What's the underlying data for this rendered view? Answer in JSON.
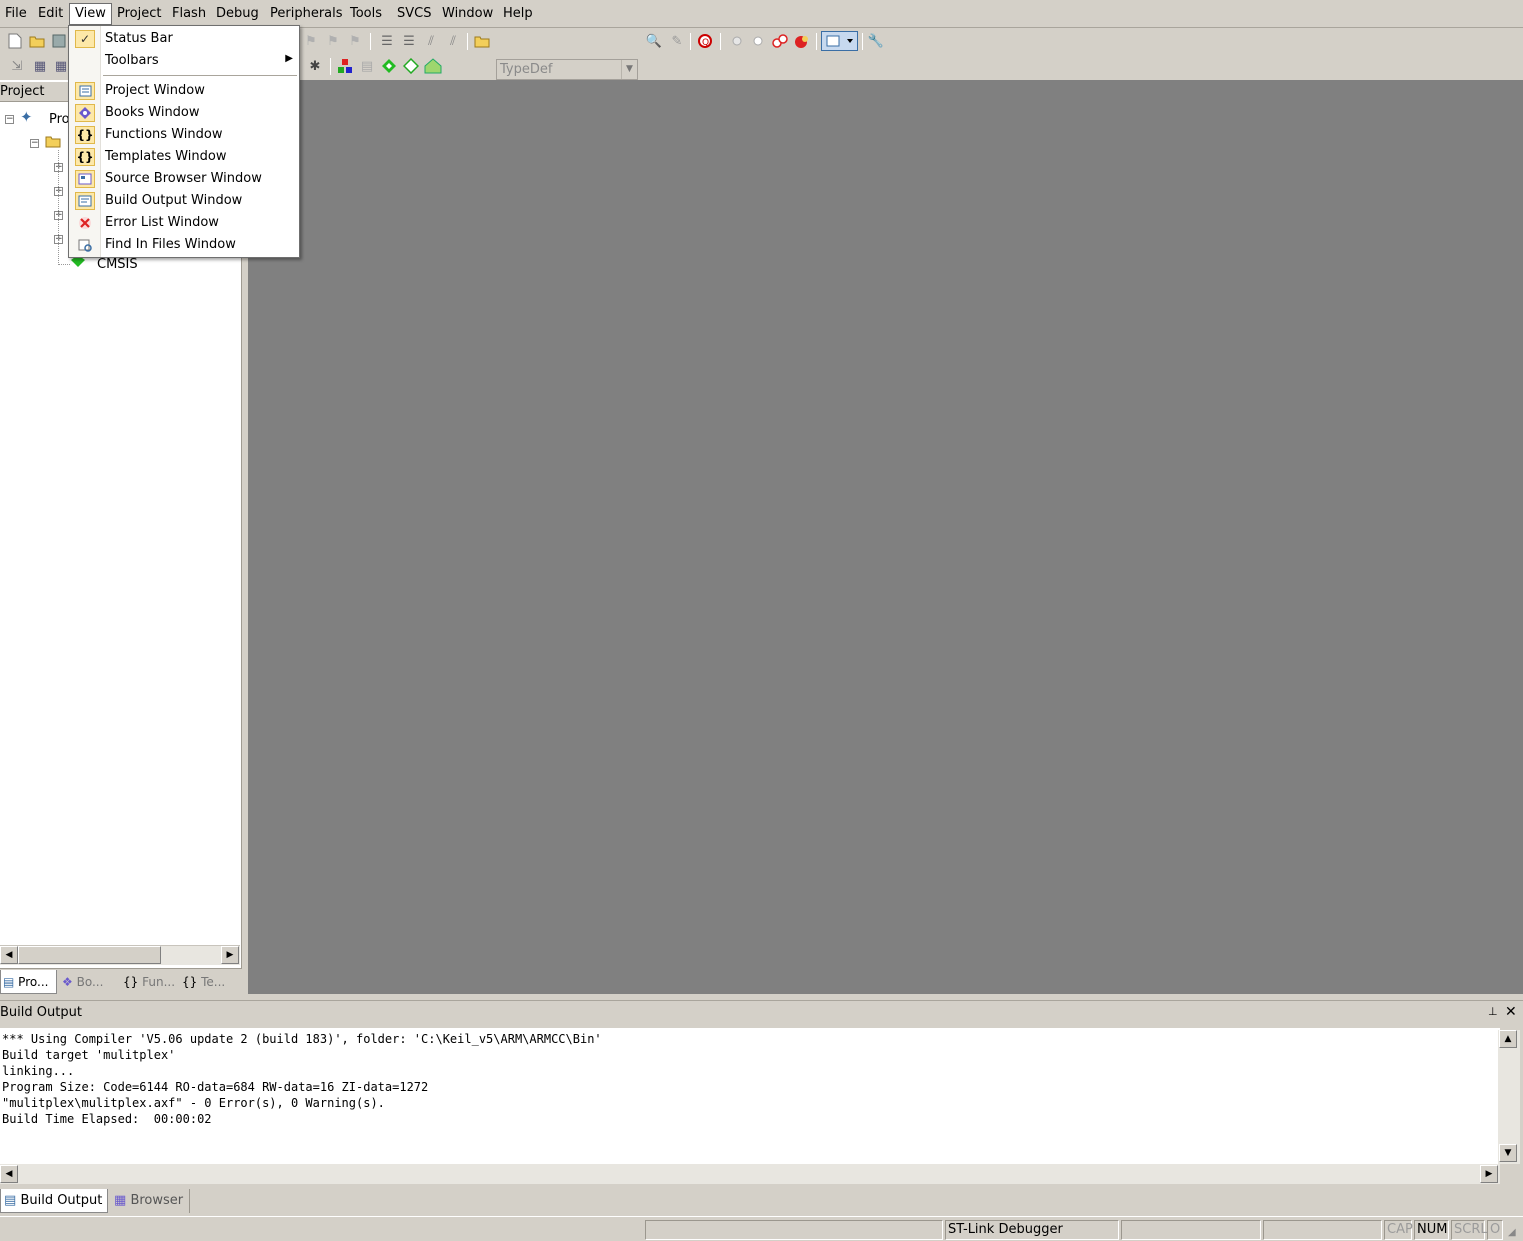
{
  "menubar": {
    "items": [
      "File",
      "Edit",
      "View",
      "Project",
      "Flash",
      "Debug",
      "Peripherals",
      "Tools",
      "SVCS",
      "Window",
      "Help"
    ]
  },
  "toolbar": {
    "find_combo_value": "TypeDef"
  },
  "view_menu": {
    "items": [
      {
        "label": "Status Bar",
        "icon": "check-icon",
        "checked": true
      },
      {
        "label": "Toolbars",
        "icon": "",
        "submenu": true
      },
      {
        "label": "Project Window",
        "icon": "project-window-icon"
      },
      {
        "label": "Books Window",
        "icon": "books-window-icon"
      },
      {
        "label": "Functions Window",
        "icon": "functions-window-icon"
      },
      {
        "label": "Templates Window",
        "icon": "templates-window-icon"
      },
      {
        "label": "Source Browser Window",
        "icon": "source-browser-icon"
      },
      {
        "label": "Build Output Window",
        "icon": "build-output-icon"
      },
      {
        "label": "Error List Window",
        "icon": "error-list-icon"
      },
      {
        "label": "Find In Files Window",
        "icon": "find-in-files-icon"
      }
    ],
    "submenu_arrow": "▶",
    "check_mark": "✓"
  },
  "project_panel": {
    "title": "Project",
    "tree": {
      "root_label": "Pro",
      "cmsis_label": "CMSIS"
    },
    "tabs": [
      "Pro...",
      "Bo...",
      "Fun...",
      "Te..."
    ]
  },
  "build_output": {
    "title": "Build Output",
    "lines": [
      "*** Using Compiler 'V5.06 update 2 (build 183)', folder: 'C:\\Keil_v5\\ARM\\ARMCC\\Bin'",
      "Build target 'mulitplex'",
      "linking...",
      "Program Size: Code=6144 RO-data=684 RW-data=16 ZI-data=1272",
      "\"mulitplex\\mulitplex.axf\" - 0 Error(s), 0 Warning(s).",
      "Build Time Elapsed:  00:00:02"
    ],
    "pin_glyph": "📌",
    "close_glyph": "✕"
  },
  "bottom_tabs": [
    "Build Output",
    "Browser"
  ],
  "statusbar": {
    "debugger": "ST-Link Debugger",
    "cap": "CAP",
    "num": "NUM",
    "scrl": "SCRL",
    "ovr": "O"
  },
  "colors": {
    "chrome": "#d4d0c8",
    "editor_bg": "#808080",
    "menu_highlight_border": "#e0b84a"
  }
}
